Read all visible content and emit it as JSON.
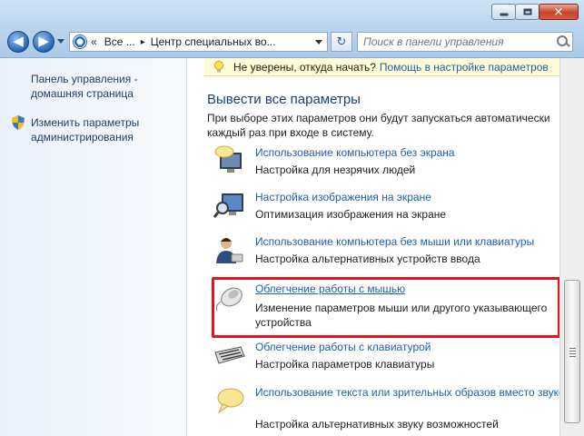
{
  "window": {
    "min_label": "",
    "max_label": "",
    "close_label": "✕"
  },
  "nav": {
    "back_glyph": "◀",
    "forward_glyph": "▶"
  },
  "address": {
    "crumbs": [
      "«",
      "Все ...",
      "▸",
      "Центр специальных во..."
    ],
    "refresh_glyph": "↻"
  },
  "search": {
    "placeholder": "Поиск в панели управления"
  },
  "sidebar": {
    "home_link": "Панель управления - домашняя страница",
    "admin_link": "Изменить параметры администрирования"
  },
  "notice": {
    "text": "Не уверены, откуда начать?",
    "link": "Помощь в настройке параметров"
  },
  "section": {
    "title": "Вывести все параметры",
    "desc": "При выборе этих параметров они будут запускаться автоматически каждый раз при входе в систему."
  },
  "items": [
    {
      "link": "Использование компьютера без экрана",
      "desc": "Настройка для незрячих людей"
    },
    {
      "link": "Настройка изображения на экране",
      "desc": "Оптимизация изображения на экране"
    },
    {
      "link": "Использование компьютера без мыши или клавиатуры",
      "desc": "Настройка альтернативных устройств ввода"
    },
    {
      "link": "Облегчение работы с мышью",
      "desc": "Изменение параметров мыши или другого указывающего устройства"
    },
    {
      "link": "Облегчение работы с клавиатурой",
      "desc": "Настройка параметров клавиатуры"
    },
    {
      "link": "Использование текста или зрительных образов вместо звуков",
      "desc": "Настройка альтернативных звуку возможностей"
    }
  ],
  "colors": {
    "link": "#1e5fad",
    "highlight": "#e0141e",
    "section_title": "#1e3d78"
  }
}
